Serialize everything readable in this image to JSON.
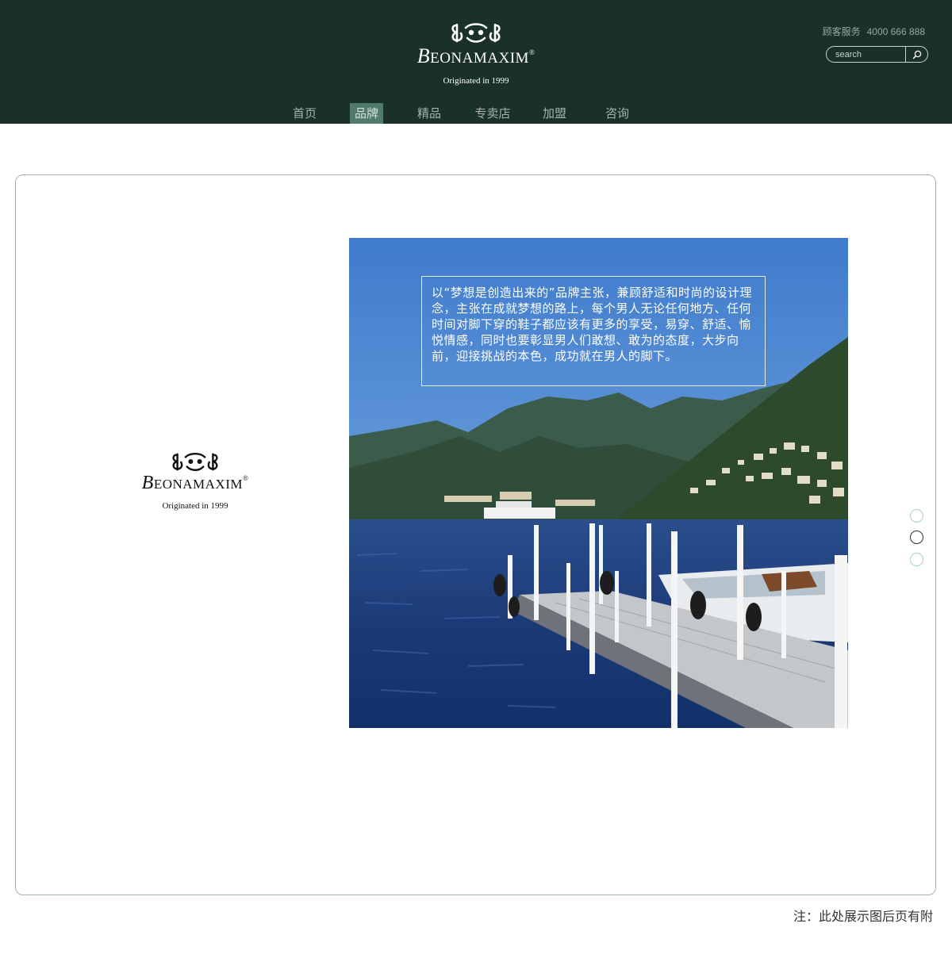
{
  "header": {
    "brand": {
      "initial": "B",
      "rest": "EONAMAXIM",
      "mark": "®",
      "tagline": "Originated in 1999"
    },
    "hotline": {
      "label": "顾客服务",
      "number": "4000 666 888"
    },
    "search": {
      "placeholder": "search"
    },
    "nav": [
      {
        "label": "首页",
        "active": false
      },
      {
        "label": "品牌",
        "active": true
      },
      {
        "label": "精品",
        "active": false
      },
      {
        "label": "专卖店",
        "active": false
      },
      {
        "label": "加盟",
        "active": false
      },
      {
        "label": "咨询",
        "active": false
      }
    ],
    "colors": {
      "background": "#1a302a",
      "active_tab": "#4f7a6c"
    }
  },
  "slide": {
    "brand": {
      "initial": "B",
      "rest": "EONAMAXIM",
      "mark": "®",
      "tagline": "Originated in 1999"
    },
    "quote": "以“梦想是创造出来的”品牌主张，兼顾舒适和时尚的设计理念，主张在成就梦想的路上，每个男人无论任何地方、任何时间对脚下穿的鞋子都应该有更多的享受，易穿、舒适、愉悦情感，同时也要彰显男人们敢想、敢为的态度，大步向前，迎接挑战的本色，成功就在男人的脚下。",
    "pagination": {
      "total": 3,
      "active_index": 1
    }
  },
  "footnote": "注：此处展示图后页有附"
}
